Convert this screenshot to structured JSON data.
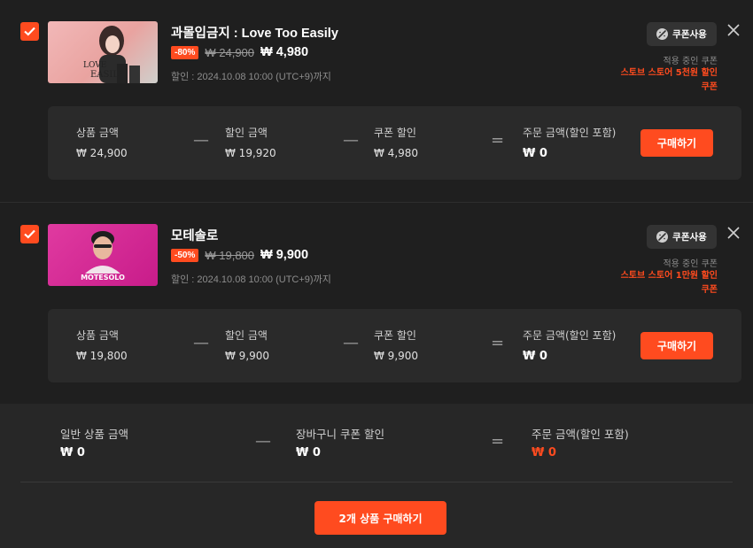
{
  "currency_symbol": "₩",
  "accent_color": "#ff4b1f",
  "items": [
    {
      "checked": true,
      "title": "과몰입금지 : Love Too Easily",
      "thumb_text": "LOVE TOO EASILY",
      "discount_badge": "-80%",
      "original_price": "₩ 24,900",
      "final_price": "₩ 4,980",
      "sale_period": "할인 : 2024.10.08 10:00 (UTC+9)까지",
      "coupon_button": "쿠폰사용",
      "applied_coupon_label": "적용 중인 쿠폰",
      "applied_coupon_name": "스토브 스토어 5천원 할인 쿠폰",
      "summary": {
        "product_amount_label": "상품 금액",
        "product_amount": "₩ 24,900",
        "discount_amount_label": "할인 금액",
        "discount_amount": "₩ 19,920",
        "coupon_discount_label": "쿠폰 할인",
        "coupon_discount": "₩ 4,980",
        "order_amount_label": "주문 금액(할인 포함)",
        "order_amount": "₩ 0",
        "buy_label": "구매하기"
      }
    },
    {
      "checked": true,
      "title": "모테솔로",
      "thumb_text": "MOTESOLO",
      "discount_badge": "-50%",
      "original_price": "₩ 19,800",
      "final_price": "₩ 9,900",
      "sale_period": "할인 : 2024.10.08 10:00 (UTC+9)까지",
      "coupon_button": "쿠폰사용",
      "applied_coupon_label": "적용 중인 쿠폰",
      "applied_coupon_name": "스토브 스토어 1만원 할인 쿠폰",
      "summary": {
        "product_amount_label": "상품 금액",
        "product_amount": "₩ 19,800",
        "discount_amount_label": "할인 금액",
        "discount_amount": "₩ 9,900",
        "coupon_discount_label": "쿠폰 할인",
        "coupon_discount": "₩ 9,900",
        "order_amount_label": "주문 금액(할인 포함)",
        "order_amount": "₩ 0",
        "buy_label": "구매하기"
      }
    }
  ],
  "footer": {
    "general_amount_label": "일반 상품 금액",
    "general_amount": "₩ 0",
    "cart_coupon_label": "장바구니 쿠폰 할인",
    "cart_coupon": "₩ 0",
    "order_total_label": "주문 금액(할인 포함)",
    "order_total": "₩ 0",
    "buy_all_label": "2개 상품 구매하기"
  }
}
